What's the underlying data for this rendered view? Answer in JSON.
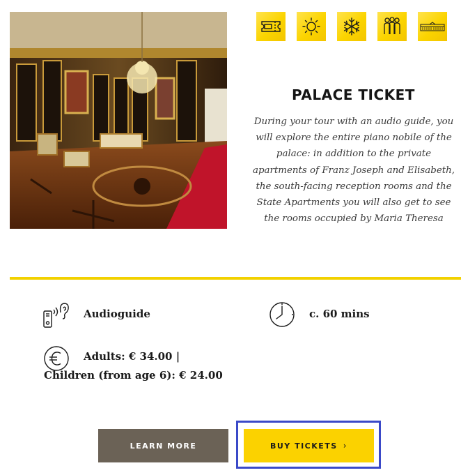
{
  "colors": {
    "accent_yellow": "#fbd200",
    "divider_yellow": "#f2d100",
    "learn_more_bg": "#6b6256",
    "focus_outline": "#3a49c8"
  },
  "feature_icons": [
    {
      "name": "ticket-icon"
    },
    {
      "name": "sun-icon"
    },
    {
      "name": "snowflake-icon"
    },
    {
      "name": "group-icon"
    },
    {
      "name": "palace-icon"
    }
  ],
  "photo": {
    "name": "palace-room-photo"
  },
  "ticket": {
    "title": "PALACE TICKET",
    "description": "During your tour with an audio guide, you will explore the entire piano nobile of the palace: in addition to the private apartments of Franz Joseph and Elisabeth, the south-facing reception rooms and the State Apartments you will also get to see the rooms occupied by Maria Theresa"
  },
  "info": {
    "guide": {
      "icon": "audioguide-icon",
      "text": "Audioguide"
    },
    "duration": {
      "icon": "clock-icon",
      "text": "c. 60 mins"
    },
    "price": {
      "icon": "euro-icon",
      "line1": "Adults: € 34.00 |",
      "line2": "Children (from age 6): € 24.00"
    }
  },
  "buttons": {
    "learn_more": "LEARN MORE",
    "buy_tickets": "BUY TICKETS",
    "buy_chevron": "›"
  }
}
